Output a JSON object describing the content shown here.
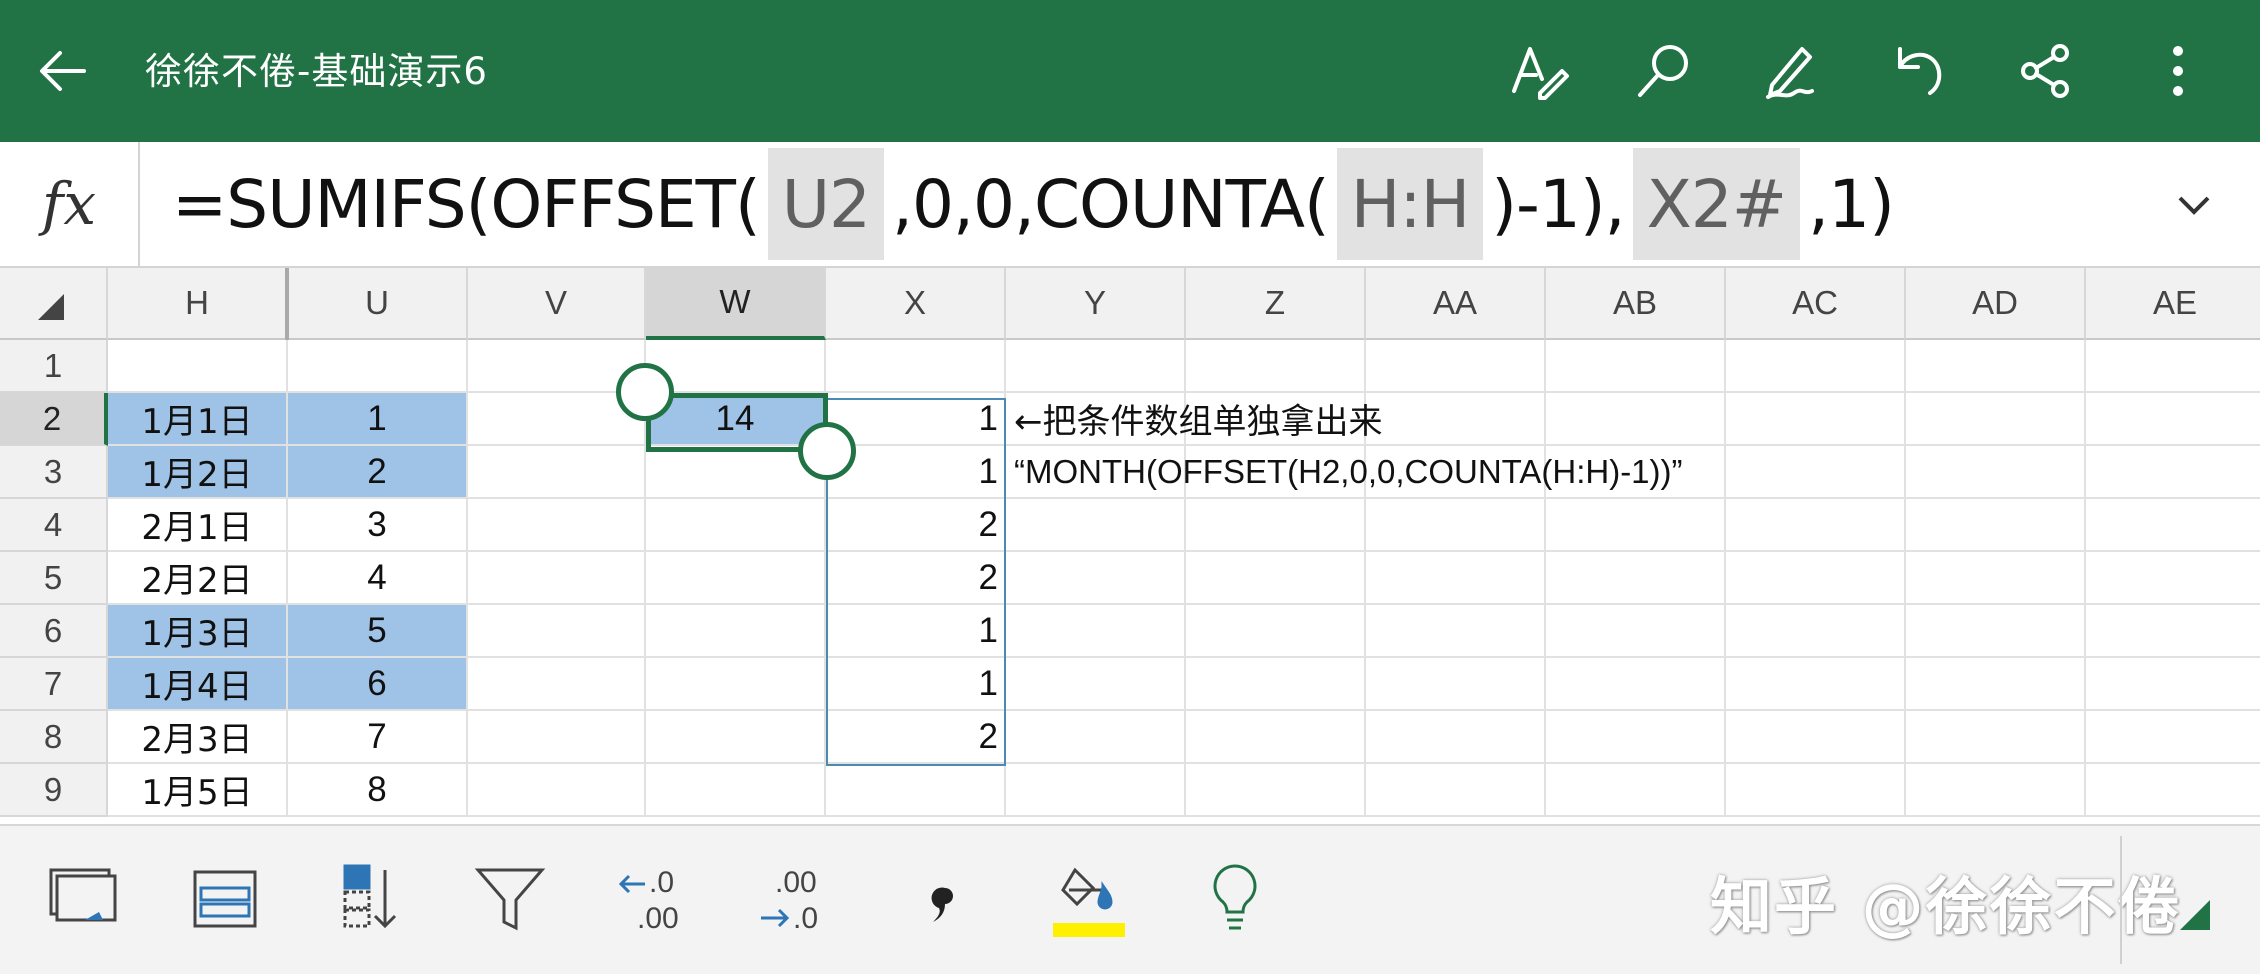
{
  "app": {
    "title": "徐徐不倦-基础演示6",
    "accent_color": "#217346",
    "icons": [
      "back-arrow-icon",
      "text-format-icon",
      "search-icon",
      "pen-draw-icon",
      "undo-icon",
      "share-icon",
      "more-vertical-icon"
    ]
  },
  "formula_bar": {
    "fx_label": "fx",
    "parts": [
      "=SUMIFS(OFFSET(",
      "U2",
      ",0,0,COUNTA(",
      "H:H",
      ")-1),",
      "X2#",
      ",1)"
    ]
  },
  "columns": [
    "H",
    "U",
    "V",
    "W",
    "X",
    "Y",
    "Z",
    "AA",
    "AB",
    "AC",
    "AD",
    "AE"
  ],
  "rows": [
    "1",
    "2",
    "3",
    "4",
    "5",
    "6",
    "7",
    "8",
    "9"
  ],
  "grid": {
    "H": [
      "",
      "1月1日",
      "1月2日",
      "2月1日",
      "2月2日",
      "1月3日",
      "1月4日",
      "2月3日",
      "1月5日"
    ],
    "U": [
      "",
      "1",
      "2",
      "3",
      "4",
      "5",
      "6",
      "7",
      "8"
    ],
    "W": [
      "",
      "14",
      "",
      "",
      "",
      "",
      "",
      "",
      ""
    ],
    "X": [
      "",
      "1",
      "1",
      "2",
      "2",
      "1",
      "1",
      "2",
      ""
    ],
    "Y2": "←把条件数组单独拿出来",
    "Y3": "“MONTH(OFFSET(H2,0,0,COUNTA(H:H)-1))”"
  },
  "highlight": {
    "fill_color": "#9fc3e7",
    "rows": [
      2,
      3,
      6,
      7
    ],
    "active_cell": "W2",
    "spill_range": "X2:X8"
  },
  "toolbar": {
    "icons": [
      "sheet-view-icon",
      "freeze-panes-icon",
      "sort-icon",
      "filter-icon",
      "decrease-decimal-icon",
      "increase-decimal-icon",
      "comma-style-icon",
      "fill-color-icon",
      "lightbulb-icon"
    ],
    "fill_color_swatch": "#ffef00",
    "watermark": "知乎 @徐徐不倦"
  }
}
